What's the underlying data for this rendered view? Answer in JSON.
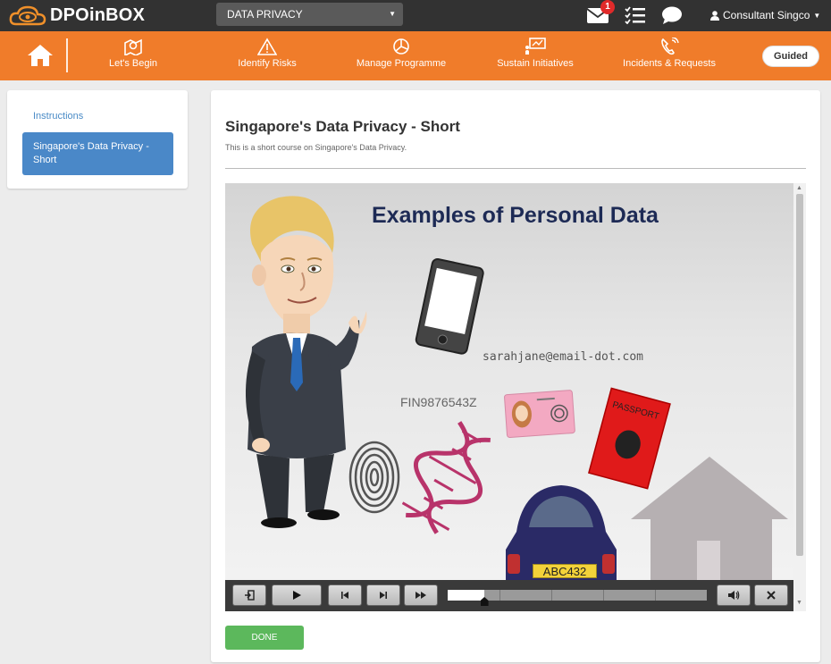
{
  "app": {
    "name": "DPOinBOX",
    "module": "DATA PRIVACY",
    "notifications_count": "1",
    "user_name": "Consultant Singco"
  },
  "nav": {
    "items": [
      {
        "label": "Let's Begin",
        "icon": "compass-map-icon"
      },
      {
        "label": "Identify Risks",
        "icon": "warning-triangle-icon"
      },
      {
        "label": "Manage Programme",
        "icon": "pie-chart-icon"
      },
      {
        "label": "Sustain Initiatives",
        "icon": "presentation-icon"
      },
      {
        "label": "Incidents & Requests",
        "icon": "phone-call-icon"
      }
    ],
    "guided_label": "Guided"
  },
  "sidebar": {
    "instructions_label": "Instructions",
    "active_item": "Singapore's Data Privacy - Short"
  },
  "course": {
    "title": "Singapore's Data Privacy - Short",
    "description": "This is a short course on Singapore's Data Privacy."
  },
  "slide": {
    "title": "Examples of Personal Data",
    "email": "sarahjane@email-dot.com",
    "fin": "FIN9876543Z",
    "passport": "PASSPORT",
    "plate": "ABC432"
  },
  "player": {
    "progress": 0.14
  },
  "done_label": "DONE",
  "colors": {
    "topbar": "#323232",
    "accent_orange": "#f07c2a",
    "active_blue": "#4a88c8",
    "done_green": "#5cb85c",
    "badge_red": "#e02a2a"
  }
}
